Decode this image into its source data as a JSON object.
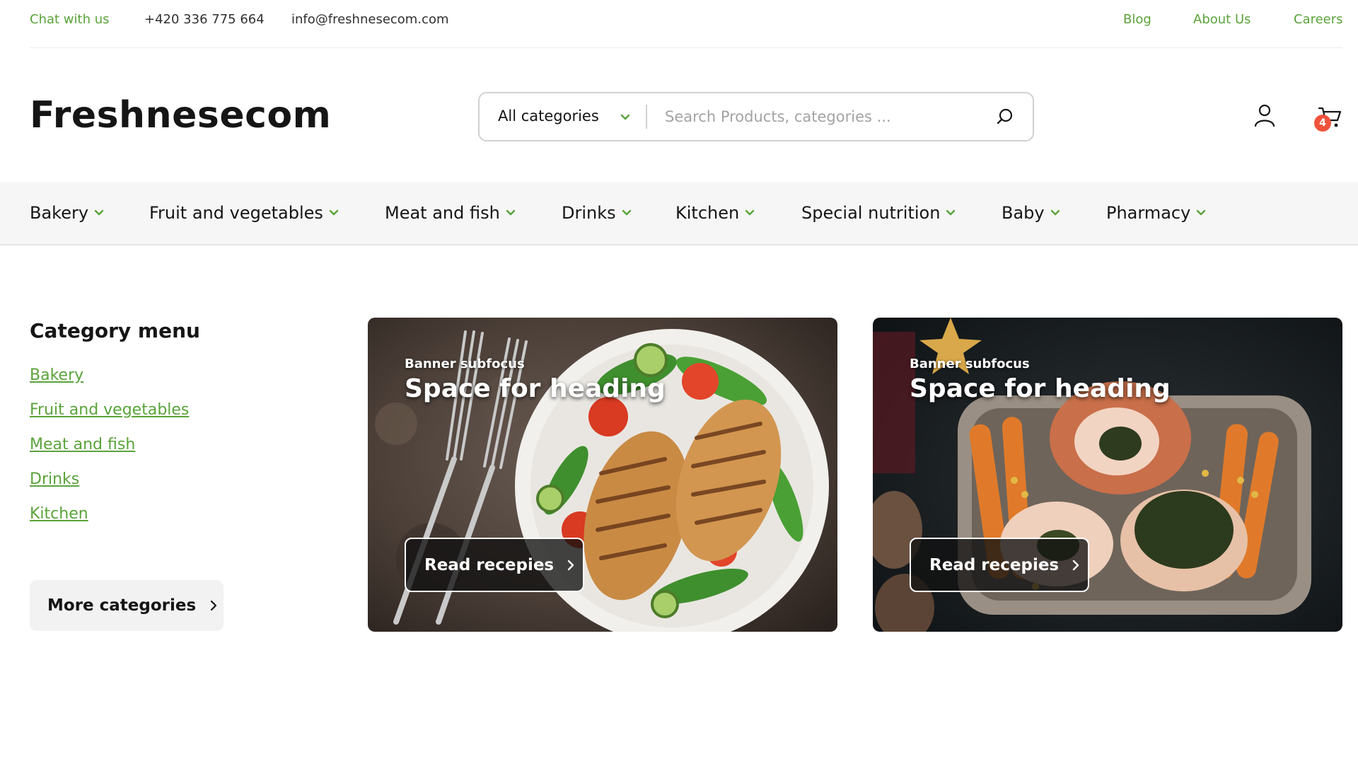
{
  "topbar": {
    "chat": "Chat with us",
    "phone": "+420 336 775 664",
    "email": "info@freshnesecom.com",
    "links": [
      "Blog",
      "About Us",
      "Careers"
    ]
  },
  "header": {
    "logo": "Freshnesecom",
    "category_select": "All categories",
    "search_placeholder": "Search Products, categories ...",
    "cart_count": "4"
  },
  "nav": {
    "items": [
      "Bakery",
      "Fruit and vegetables",
      "Meat and fish",
      "Drinks",
      "Kitchen",
      "Special nutrition",
      "Baby",
      "Pharmacy"
    ]
  },
  "sidebar": {
    "title": "Category menu",
    "links": [
      "Bakery",
      "Fruit and vegetables",
      "Meat and fish",
      "Drinks",
      "Kitchen"
    ],
    "more_button": "More categories"
  },
  "banners": [
    {
      "subfocus": "Banner subfocus",
      "heading": "Space for heading",
      "button": "Read recepies"
    },
    {
      "subfocus": "Banner subfocus",
      "heading": "Space for heading",
      "button": "Read recepies"
    }
  ],
  "colors": {
    "accent_green": "#5aa33a",
    "badge_red": "#f0533c",
    "nav_background": "#f6f6f6"
  },
  "icons": [
    "chevron-down-icon",
    "search-icon",
    "user-icon",
    "cart-icon",
    "chevron-right-icon"
  ]
}
